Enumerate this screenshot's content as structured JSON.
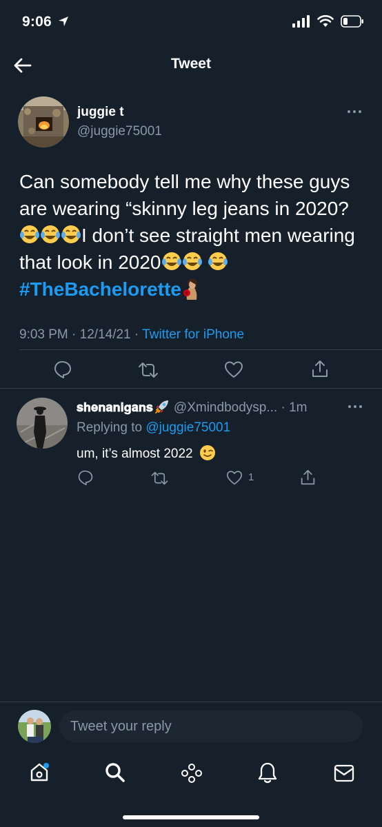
{
  "status_bar": {
    "time": "9:06"
  },
  "header": {
    "title": "Tweet"
  },
  "tweet": {
    "author_name": "juggie t",
    "author_handle": "@juggie75001",
    "text_part1": "Can somebody tell me why these guys are wearing “skinny leg jeans in 2020?",
    "text_part2": "I don’t see straight men wearing that look in 2020",
    "hashtag": "#TheBachelorette",
    "time": "9:03 PM",
    "date": "12/14/21",
    "source": "Twitter for iPhone"
  },
  "reply": {
    "author_name": "𝐬𝐡𝐞𝐧𝐚𝐧𝐢𝐠𝐚𝐧𝐬",
    "author_handle": "@Xmindbodysp...",
    "age": "1m",
    "replying_label": "Replying to",
    "replying_to": "@juggie75001",
    "text": "um, it’s almost 2022",
    "like_count": "1"
  },
  "composer": {
    "placeholder": "Tweet your reply"
  },
  "colors": {
    "background": "#15202b",
    "accent": "#1d9bf0",
    "muted": "#8b98a5",
    "divider": "#38444d"
  },
  "icons": [
    "back-arrow-icon",
    "more-icon",
    "reply-icon",
    "retweet-icon",
    "like-icon",
    "share-icon",
    "home-icon",
    "search-icon",
    "spaces-icon",
    "notifications-icon",
    "messages-icon"
  ]
}
